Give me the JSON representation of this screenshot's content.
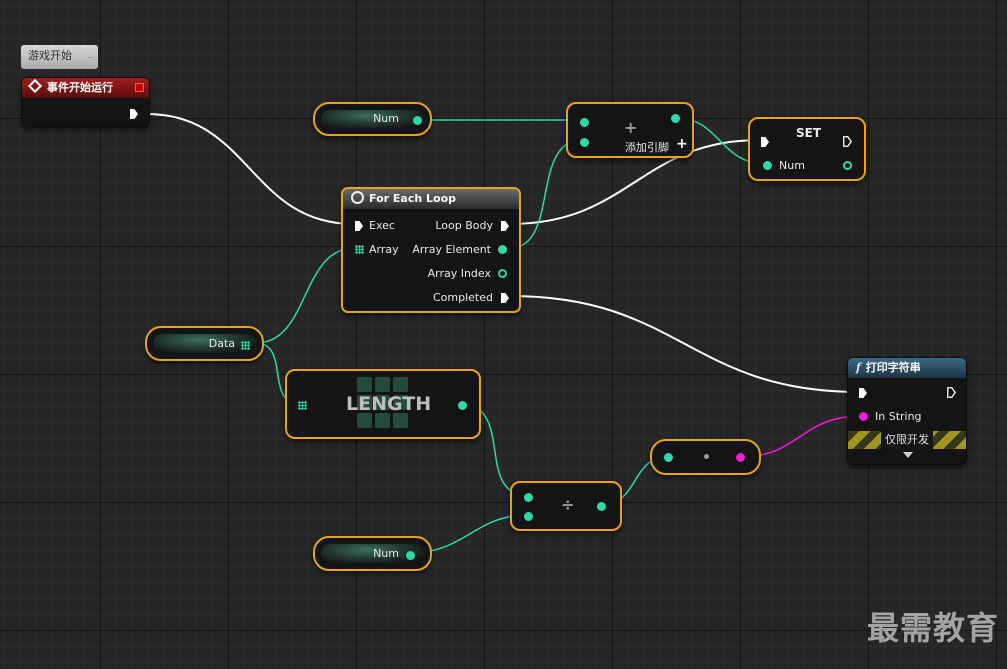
{
  "comment": {
    "text": "游戏开始"
  },
  "event_node": {
    "title": "事件开始运行"
  },
  "num_var_top": {
    "label": "Num"
  },
  "add_node": {
    "add_pin_label": "添加引脚",
    "symbol": "+"
  },
  "set_node": {
    "title": "SET",
    "pin_label": "Num"
  },
  "for_each": {
    "title": "For Each Loop",
    "inputs": [
      "Exec",
      "Array"
    ],
    "outputs": [
      "Loop Body",
      "Array Element",
      "Array Index",
      "Completed"
    ]
  },
  "data_var": {
    "label": "Data"
  },
  "length_node": {
    "label": "LENGTH"
  },
  "divide_node": {
    "symbol": "÷"
  },
  "convert_node": {
    "symbol": "•"
  },
  "num_var_bottom": {
    "label": "Num"
  },
  "print_node": {
    "title": "打印字符串",
    "pin_label": "In String",
    "dev_label": "仅限开发"
  },
  "watermark": {
    "text": "最需教育"
  },
  "colors": {
    "exec": "#ffffff",
    "int_pin": "#2fd8a8",
    "string_pin": "#f21ad2",
    "selection": "#e8a317",
    "event_header": "#a01e1e",
    "function_header": "#3d6a85"
  }
}
